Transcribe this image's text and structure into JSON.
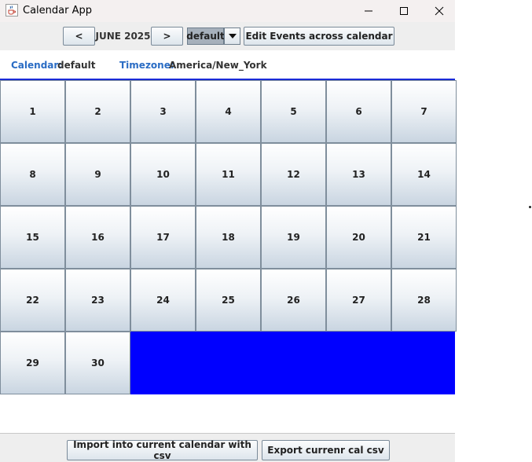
{
  "window": {
    "title": "Calendar App",
    "icon": "java-cup-icon"
  },
  "toolbar": {
    "prev_label": "<",
    "next_label": ">",
    "month_label": "JUNE 2025",
    "calendar_select_value": "default",
    "edit_events_label": "Edit Events across calendar"
  },
  "info": {
    "calendar_key": "Calendar:",
    "calendar_value": "default",
    "timezone_key": "Timezone:",
    "timezone_value": "America/New_York"
  },
  "days": [
    "1",
    "2",
    "3",
    "4",
    "5",
    "6",
    "7",
    "8",
    "9",
    "10",
    "11",
    "12",
    "13",
    "14",
    "15",
    "16",
    "17",
    "18",
    "19",
    "20",
    "21",
    "22",
    "23",
    "24",
    "25",
    "26",
    "27",
    "28",
    "29",
    "30"
  ],
  "bottom": {
    "import_label": "Import into current calendar with csv",
    "export_label": "Export currenr cal csv"
  },
  "colors": {
    "accent_blue": "#0000ff",
    "label_blue": "#2a6cc4"
  }
}
